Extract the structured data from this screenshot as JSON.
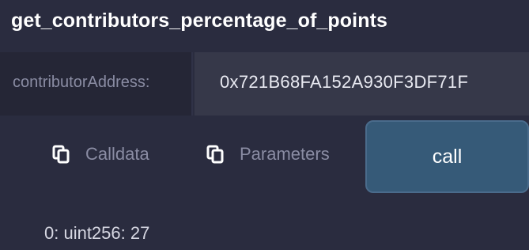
{
  "function": {
    "name": "get_contributors_percentage_of_points"
  },
  "input": {
    "label": "contributorAddress:",
    "value": "0x721B68FA152A930F3DF71F"
  },
  "actions": {
    "calldata_label": "Calldata",
    "parameters_label": "Parameters",
    "call_label": "call"
  },
  "output": {
    "result": "0: uint256: 27"
  },
  "icons": {
    "copy": "copy-icon"
  },
  "colors": {
    "background": "#2a2c3f",
    "input_background": "#363849",
    "call_button": "#365a78",
    "muted_text": "#8a8ca3"
  }
}
